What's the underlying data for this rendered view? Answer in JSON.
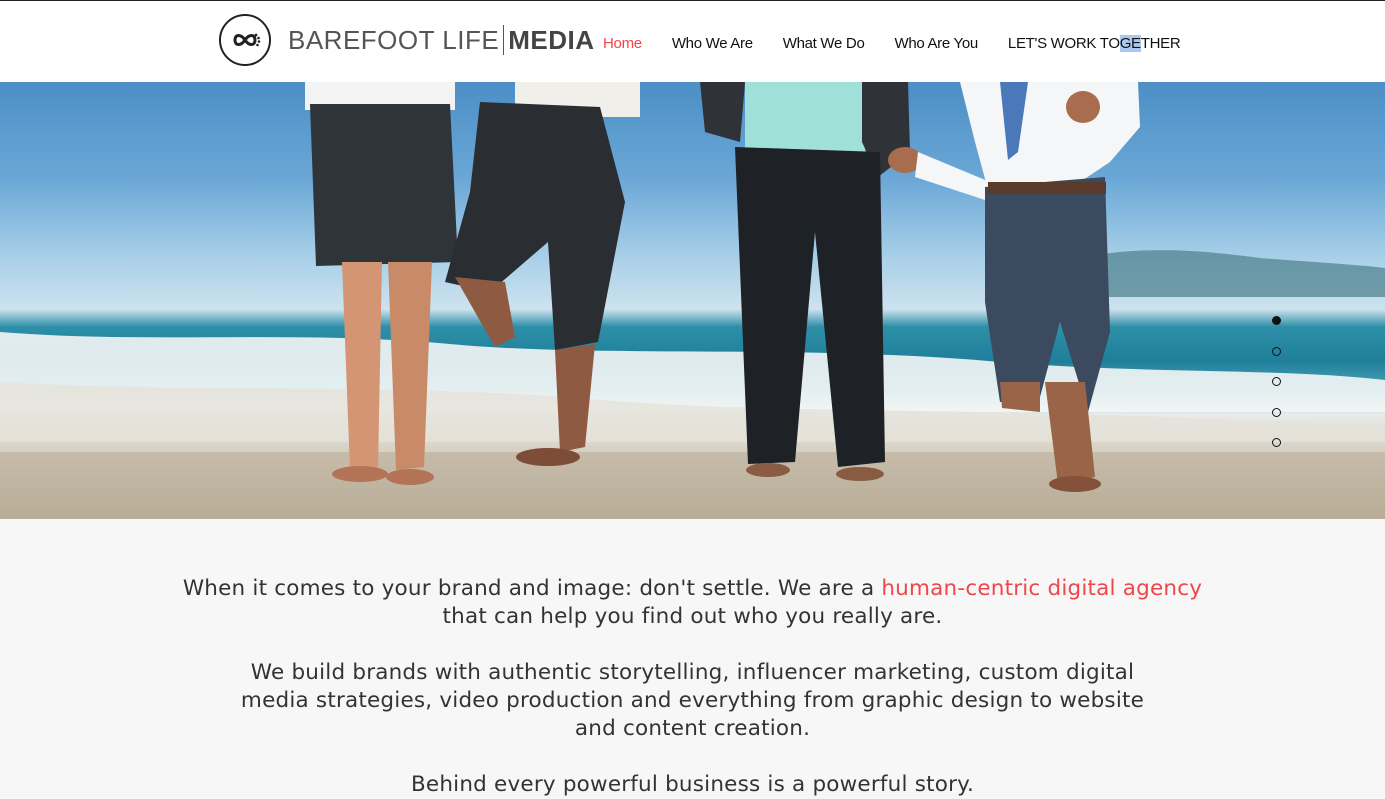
{
  "brand": {
    "name_light": "BAREFOOT LIFE",
    "name_bold": "MEDIA"
  },
  "nav": {
    "items": [
      {
        "label": "Home",
        "active": true
      },
      {
        "label": "Who We Are",
        "active": false
      },
      {
        "label": "What We Do",
        "active": false
      },
      {
        "label": "Who Are You",
        "active": false
      },
      {
        "label": "LET'S WORK TOGETHER",
        "active": false
      }
    ],
    "last_pre": "LET'S WORK TO",
    "last_hl": "GE",
    "last_post": "THER"
  },
  "slider": {
    "count": 5,
    "active_index": 0
  },
  "content": {
    "intro_pre": "When it comes to your brand and image: don't settle. We are a ",
    "intro_accent": "human-centric digital agency",
    "intro_post": "that can help you find out who you really are.",
    "services": "We build brands with authentic storytelling, influencer marketing, custom digital media strategies, video production and everything from graphic design to website and content creation.",
    "tagline": "Behind every powerful business is a powerful story."
  },
  "colors": {
    "accent": "#f2454a",
    "text": "#333333",
    "background": "#f7f7f7"
  }
}
